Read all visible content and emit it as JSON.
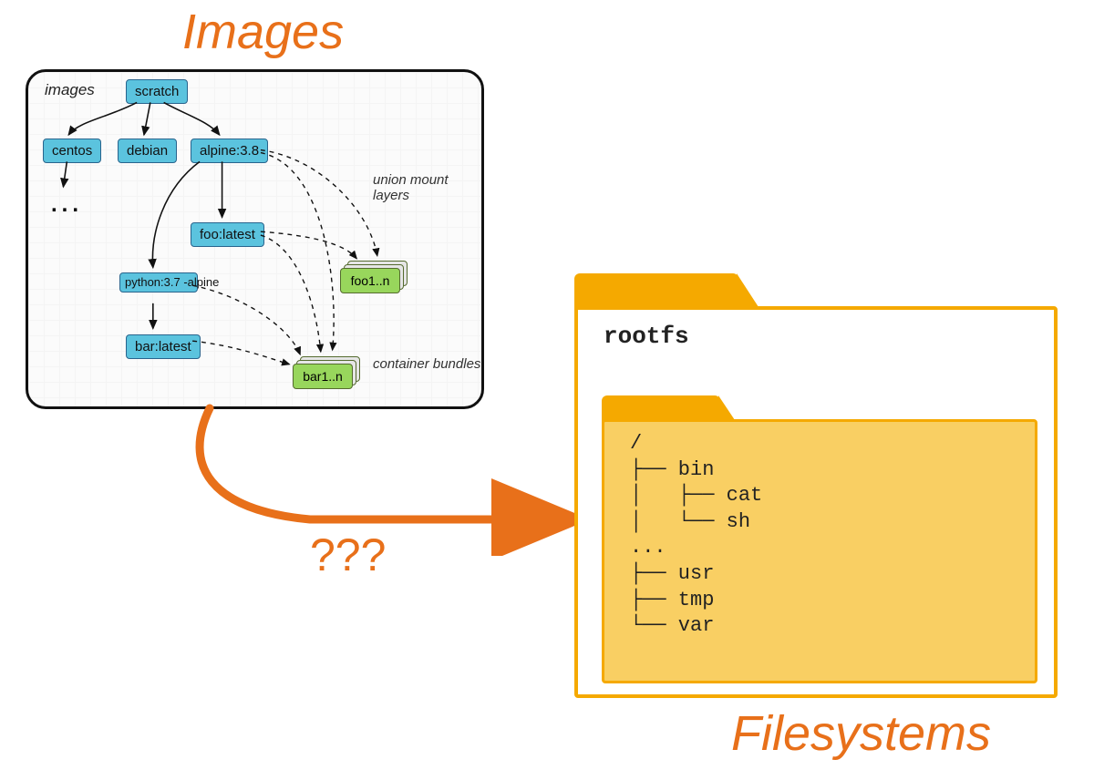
{
  "headings": {
    "images": "Images",
    "filesystems": "Filesystems",
    "question": "???"
  },
  "panel": {
    "label": "images",
    "nodes": {
      "scratch": "scratch",
      "centos": "centos",
      "debian": "debian",
      "alpine": "alpine:3.8",
      "foo": "foo:latest",
      "python": "python:3.7\n-alpine",
      "bar": "bar:latest"
    },
    "bundles": {
      "foo": "foo1..n",
      "bar": "bar1..n"
    },
    "annot": {
      "union": "union mount\nlayers",
      "bundles": "container\nbundles",
      "dots": "..."
    }
  },
  "folder": {
    "rootfs": "rootfs",
    "tree": "/\n├── bin\n│   ├── cat\n│   └── sh\n...\n├── usr\n├── tmp\n└── var"
  }
}
